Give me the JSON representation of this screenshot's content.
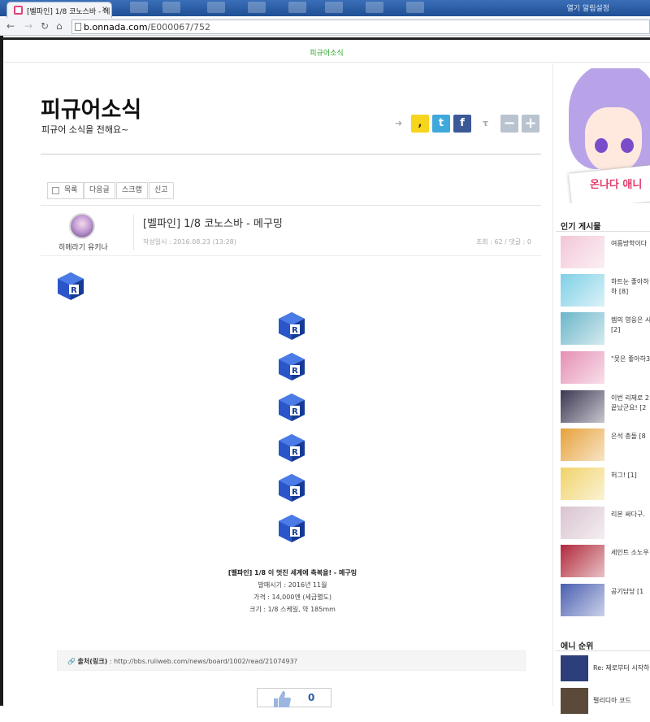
{
  "browser": {
    "tab_title": "[벨파인] 1/8 코노스바 - 메",
    "tab_close": "×",
    "url_host": "b.onnada.com",
    "url_path": "/E000067/752",
    "tray_text": "열기  알림설정"
  },
  "site": {
    "top_nav": "피규어소식",
    "title": "피규어소식",
    "subtitle": "피규어 소식을 전해요~"
  },
  "toolbar": {
    "list": "목록",
    "next": "다음글",
    "scrap": "스크랩",
    "report": "신고"
  },
  "post": {
    "author": "히메라기 유키나",
    "title": "[벨파인] 1/8 코노스바 - 메구밍",
    "date": "작성일시 : 2016.08.23 (13:28)",
    "stats": "조회 : 62 / 댓글 : 0",
    "caption_title": "[벨파인] 1/8 이 멋진 세계에 축복을! - 메구밍",
    "release": "발매시기 : 2016년 11월",
    "price": "가격 : 14,000엔 (세금별도)",
    "size": "크기 : 1/8 스케일, 약 185mm",
    "source_label": "출처(링크)",
    "source_url": ": http://bbs.ruliweb.com/news/board/1002/read/2107493?",
    "like_count": "0"
  },
  "sidebar": {
    "banner_text": "온나다 애니",
    "popular_title": "인기 게시물",
    "popular_items": [
      {
        "label": "여름방학이다",
        "color": "#f2c7d8"
      },
      {
        "label": "하트눈 좋아하",
        "label2": "하  [8]",
        "color": "#7fd0e6"
      },
      {
        "label": "렘의 영웅은 시",
        "label2": "[2]",
        "color": "#6bb6c9"
      },
      {
        "label": "\"못은 좋아하3",
        "color": "#e58fb5"
      },
      {
        "label": "이번 리제로 2",
        "label2": "끝났군요!  [2",
        "color": "#3b3752"
      },
      {
        "label": "은석 총돌  [8",
        "color": "#e6a13a"
      },
      {
        "label": "허그!  [1]",
        "color": "#f0d36a"
      },
      {
        "label": "리본 싸다구.",
        "color": "#d8c3cf"
      },
      {
        "label": "세인트 소노우",
        "color": "#b0283a"
      },
      {
        "label": "공기담당  [1",
        "color": "#4a5fb0"
      }
    ],
    "rank_title": "애니 순위",
    "rank_items": [
      {
        "label": "Re: 제로부터 시작하",
        "color": "#2d3f7a"
      },
      {
        "label": "펄리디아 코드",
        "color": "#5b4a3a"
      }
    ]
  },
  "colors": {
    "accent_green": "#2aa52a",
    "kakao": "#f7d51d",
    "twitter": "#3fa9dc",
    "facebook": "#3b5998",
    "font_btn": "#b9c3cf"
  }
}
